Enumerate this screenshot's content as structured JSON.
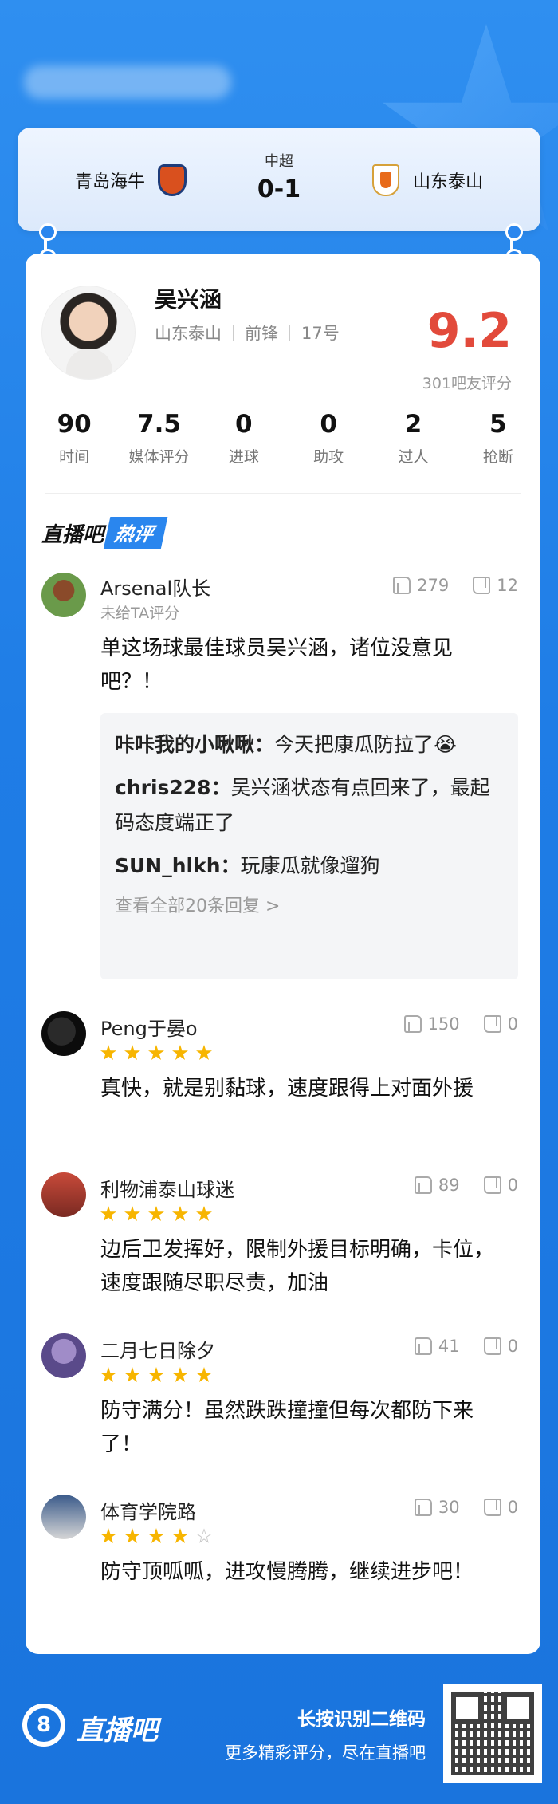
{
  "match": {
    "home_team": "青岛海牛",
    "away_team": "山东泰山",
    "league": "中超",
    "score": "0-1"
  },
  "player": {
    "name": "吴兴涵",
    "team": "山东泰山",
    "position": "前锋",
    "number": "17号",
    "rating": "9.2",
    "rating_count": "301吧友评分",
    "stats": [
      {
        "value": "90",
        "label": "时间"
      },
      {
        "value": "7.5",
        "label": "媒体评分"
      },
      {
        "value": "0",
        "label": "进球"
      },
      {
        "value": "0",
        "label": "助攻"
      },
      {
        "value": "2",
        "label": "过人"
      },
      {
        "value": "5",
        "label": "抢断"
      }
    ]
  },
  "hot": {
    "brand": "直播吧",
    "tag": "热评"
  },
  "comments": [
    {
      "user": "Arsenal队长",
      "subtitle": "未给TA评分",
      "text": "单这场球最佳球员吴兴涵，诸位没意见吧？！",
      "likes": "279",
      "dislikes": "12",
      "replies": [
        {
          "user": "咔咔我的小啾啾：",
          "text": "今天把康瓜防拉了😭"
        },
        {
          "user": "chris228：",
          "text": "吴兴涵状态有点回来了，最起码态度端正了"
        },
        {
          "user": "SUN_hlkh：",
          "text": "玩康瓜就像遛狗"
        }
      ],
      "more_replies": "查看全部20条回复 >"
    },
    {
      "user": "Peng于晏o",
      "stars": 5,
      "text": "真快，就是别黏球，速度跟得上对面外援",
      "likes": "150",
      "dislikes": "0"
    },
    {
      "user": "利物浦泰山球迷",
      "stars": 5,
      "text": "边后卫发挥好，限制外援目标明确，卡位，速度跟随尽职尽责，加油",
      "likes": "89",
      "dislikes": "0"
    },
    {
      "user": "二月七日除夕",
      "stars": 5,
      "text": "防守满分！虽然跌跌撞撞但每次都防下来了！",
      "likes": "41",
      "dislikes": "0"
    },
    {
      "user": "体育学院路",
      "stars": 4,
      "text": "防守顶呱呱，进攻慢腾腾，继续进步吧！",
      "likes": "30",
      "dislikes": "0"
    }
  ],
  "footer": {
    "logo_text": "直播吧",
    "logo_glyph": "8",
    "line1": "长按识别二维码",
    "line2": "更多精彩评分，尽在直播吧"
  }
}
